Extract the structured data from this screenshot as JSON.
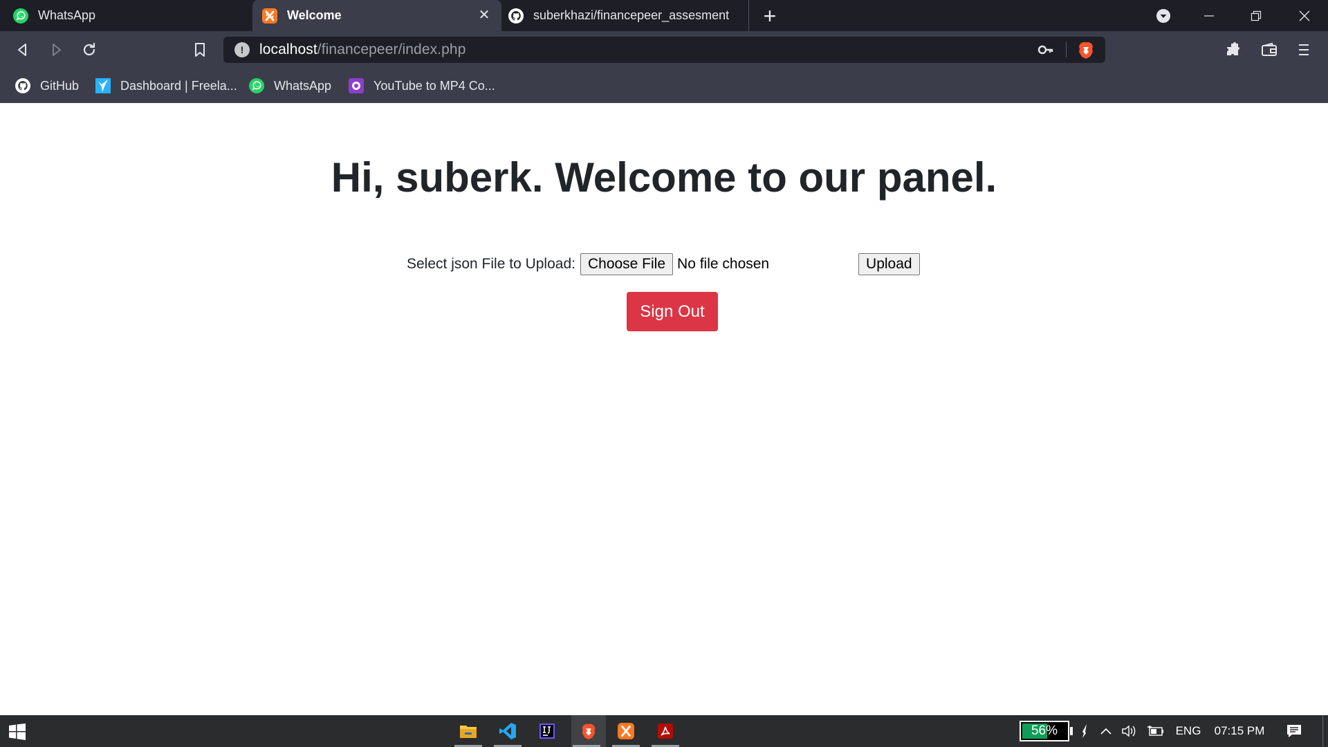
{
  "browser": {
    "tabs": [
      {
        "title": "WhatsApp",
        "icon": "whatsapp-icon",
        "active": false
      },
      {
        "title": "Welcome",
        "icon": "xampp-icon",
        "active": true
      },
      {
        "title": "suberkhazi/financepeer_assesment",
        "icon": "github-icon",
        "active": false
      }
    ],
    "url_host": "localhost",
    "url_path": "/financepeer/index.php",
    "bookmarks": [
      {
        "label": "GitHub",
        "icon": "github-icon"
      },
      {
        "label": "Dashboard | Freela...",
        "icon": "freelancer-icon"
      },
      {
        "label": "WhatsApp",
        "icon": "whatsapp-icon"
      },
      {
        "label": "YouTube to MP4 Co...",
        "icon": "youtube-converter-icon"
      }
    ]
  },
  "page": {
    "greeting_prefix": "Hi, ",
    "username": "suberk",
    "greeting_suffix": ". Welcome to our panel.",
    "upload_label": "Select json File to Upload:",
    "choose_file_label": "Choose File",
    "no_file_text": "No file chosen",
    "upload_button": "Upload",
    "signout_button": "Sign Out",
    "signout_color": "#dc3545"
  },
  "taskbar": {
    "apps": [
      "file-explorer",
      "vscode",
      "intellij",
      "brave",
      "xampp",
      "acrobat"
    ],
    "active_app": "brave",
    "battery_percent": "56%",
    "battery_level": 0.56,
    "language": "ENG",
    "time": "07:15 PM"
  },
  "colors": {
    "tab_strip": "#1e1f26",
    "toolbar": "#3b3e4a",
    "page_bg": "#ffffff",
    "taskbar": "#2b2c2e"
  }
}
